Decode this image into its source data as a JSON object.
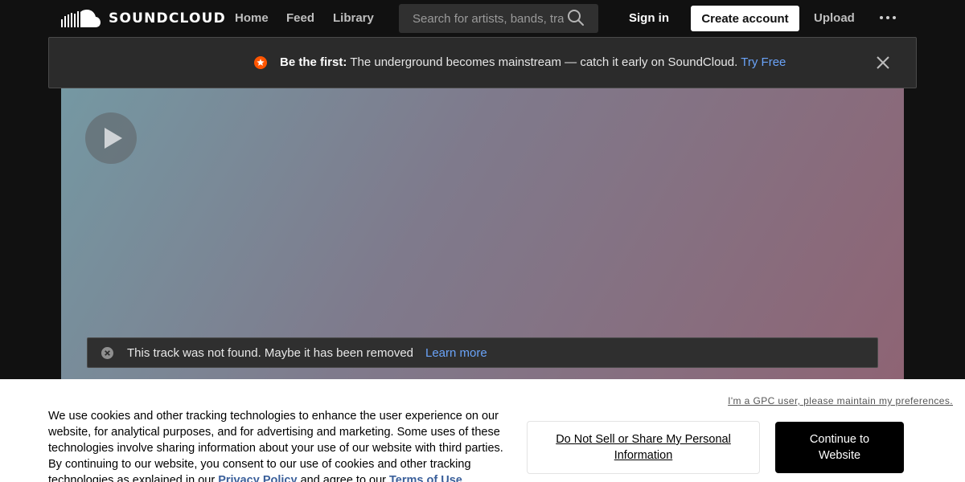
{
  "header": {
    "logo_text": "SOUNDCLOUD",
    "nav": [
      "Home",
      "Feed",
      "Library"
    ],
    "search_placeholder": "Search for artists, bands, tracks, podcasts",
    "sign_in": "Sign in",
    "create_account": "Create account",
    "upload": "Upload"
  },
  "promo": {
    "bold": "Be the first:",
    "text": "The underground becomes mainstream — catch it early on SoundCloud.",
    "link": "Try Free",
    "accent_color": "#ff5500"
  },
  "notice": {
    "text": "This track was not found. Maybe it has been removed",
    "link": "Learn more"
  },
  "cookie": {
    "gpc_link": "I'm a GPC user, please maintain my preferences.",
    "text_1": "We use cookies and other tracking technologies to enhance the user experience on our website, for analytical purposes, and for advertising and marketing. Some uses of these technologies involve sharing information about your use of our website with third parties. By continuing to our website, you consent to our use of cookies and other tracking technologies as explained in our",
    "privacy_link": "Privacy Policy",
    "text_2": "and agree to our",
    "terms_link": "Terms of Use",
    "text_3": ".",
    "dns_button": "Do Not Sell or Share My Personal Information",
    "continue_button": "Continue to Website"
  }
}
